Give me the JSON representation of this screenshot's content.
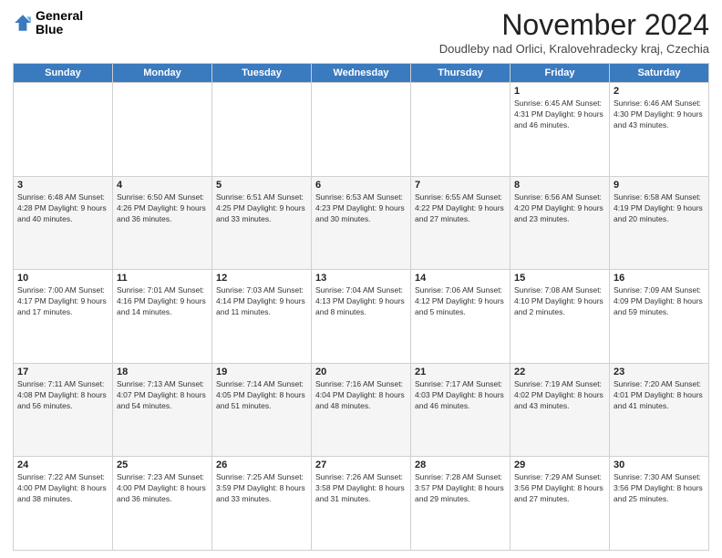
{
  "logo": {
    "line1": "General",
    "line2": "Blue"
  },
  "title": "November 2024",
  "subtitle": "Doudleby nad Orlici, Kralovehradecky kraj, Czechia",
  "days_header": [
    "Sunday",
    "Monday",
    "Tuesday",
    "Wednesday",
    "Thursday",
    "Friday",
    "Saturday"
  ],
  "weeks": [
    [
      {
        "day": "",
        "info": ""
      },
      {
        "day": "",
        "info": ""
      },
      {
        "day": "",
        "info": ""
      },
      {
        "day": "",
        "info": ""
      },
      {
        "day": "",
        "info": ""
      },
      {
        "day": "1",
        "info": "Sunrise: 6:45 AM\nSunset: 4:31 PM\nDaylight: 9 hours and 46 minutes."
      },
      {
        "day": "2",
        "info": "Sunrise: 6:46 AM\nSunset: 4:30 PM\nDaylight: 9 hours and 43 minutes."
      }
    ],
    [
      {
        "day": "3",
        "info": "Sunrise: 6:48 AM\nSunset: 4:28 PM\nDaylight: 9 hours and 40 minutes."
      },
      {
        "day": "4",
        "info": "Sunrise: 6:50 AM\nSunset: 4:26 PM\nDaylight: 9 hours and 36 minutes."
      },
      {
        "day": "5",
        "info": "Sunrise: 6:51 AM\nSunset: 4:25 PM\nDaylight: 9 hours and 33 minutes."
      },
      {
        "day": "6",
        "info": "Sunrise: 6:53 AM\nSunset: 4:23 PM\nDaylight: 9 hours and 30 minutes."
      },
      {
        "day": "7",
        "info": "Sunrise: 6:55 AM\nSunset: 4:22 PM\nDaylight: 9 hours and 27 minutes."
      },
      {
        "day": "8",
        "info": "Sunrise: 6:56 AM\nSunset: 4:20 PM\nDaylight: 9 hours and 23 minutes."
      },
      {
        "day": "9",
        "info": "Sunrise: 6:58 AM\nSunset: 4:19 PM\nDaylight: 9 hours and 20 minutes."
      }
    ],
    [
      {
        "day": "10",
        "info": "Sunrise: 7:00 AM\nSunset: 4:17 PM\nDaylight: 9 hours and 17 minutes."
      },
      {
        "day": "11",
        "info": "Sunrise: 7:01 AM\nSunset: 4:16 PM\nDaylight: 9 hours and 14 minutes."
      },
      {
        "day": "12",
        "info": "Sunrise: 7:03 AM\nSunset: 4:14 PM\nDaylight: 9 hours and 11 minutes."
      },
      {
        "day": "13",
        "info": "Sunrise: 7:04 AM\nSunset: 4:13 PM\nDaylight: 9 hours and 8 minutes."
      },
      {
        "day": "14",
        "info": "Sunrise: 7:06 AM\nSunset: 4:12 PM\nDaylight: 9 hours and 5 minutes."
      },
      {
        "day": "15",
        "info": "Sunrise: 7:08 AM\nSunset: 4:10 PM\nDaylight: 9 hours and 2 minutes."
      },
      {
        "day": "16",
        "info": "Sunrise: 7:09 AM\nSunset: 4:09 PM\nDaylight: 8 hours and 59 minutes."
      }
    ],
    [
      {
        "day": "17",
        "info": "Sunrise: 7:11 AM\nSunset: 4:08 PM\nDaylight: 8 hours and 56 minutes."
      },
      {
        "day": "18",
        "info": "Sunrise: 7:13 AM\nSunset: 4:07 PM\nDaylight: 8 hours and 54 minutes."
      },
      {
        "day": "19",
        "info": "Sunrise: 7:14 AM\nSunset: 4:05 PM\nDaylight: 8 hours and 51 minutes."
      },
      {
        "day": "20",
        "info": "Sunrise: 7:16 AM\nSunset: 4:04 PM\nDaylight: 8 hours and 48 minutes."
      },
      {
        "day": "21",
        "info": "Sunrise: 7:17 AM\nSunset: 4:03 PM\nDaylight: 8 hours and 46 minutes."
      },
      {
        "day": "22",
        "info": "Sunrise: 7:19 AM\nSunset: 4:02 PM\nDaylight: 8 hours and 43 minutes."
      },
      {
        "day": "23",
        "info": "Sunrise: 7:20 AM\nSunset: 4:01 PM\nDaylight: 8 hours and 41 minutes."
      }
    ],
    [
      {
        "day": "24",
        "info": "Sunrise: 7:22 AM\nSunset: 4:00 PM\nDaylight: 8 hours and 38 minutes."
      },
      {
        "day": "25",
        "info": "Sunrise: 7:23 AM\nSunset: 4:00 PM\nDaylight: 8 hours and 36 minutes."
      },
      {
        "day": "26",
        "info": "Sunrise: 7:25 AM\nSunset: 3:59 PM\nDaylight: 8 hours and 33 minutes."
      },
      {
        "day": "27",
        "info": "Sunrise: 7:26 AM\nSunset: 3:58 PM\nDaylight: 8 hours and 31 minutes."
      },
      {
        "day": "28",
        "info": "Sunrise: 7:28 AM\nSunset: 3:57 PM\nDaylight: 8 hours and 29 minutes."
      },
      {
        "day": "29",
        "info": "Sunrise: 7:29 AM\nSunset: 3:56 PM\nDaylight: 8 hours and 27 minutes."
      },
      {
        "day": "30",
        "info": "Sunrise: 7:30 AM\nSunset: 3:56 PM\nDaylight: 8 hours and 25 minutes."
      }
    ]
  ]
}
